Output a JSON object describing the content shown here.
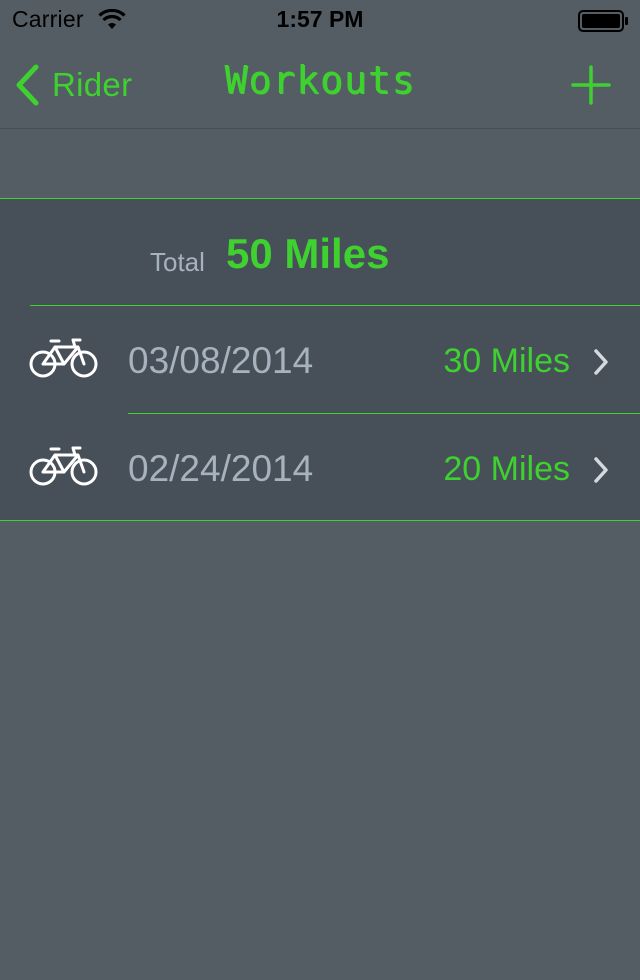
{
  "status_bar": {
    "carrier": "Carrier",
    "time": "1:57 PM"
  },
  "nav": {
    "back_label": "Rider",
    "title": "Workouts",
    "add_icon": "plus-icon"
  },
  "summary": {
    "label": "Total",
    "value": "50 Miles"
  },
  "workouts": [
    {
      "date": "03/08/2014",
      "miles": "30 Miles",
      "icon": "bicycle-icon"
    },
    {
      "date": "02/24/2014",
      "miles": "20 Miles",
      "icon": "bicycle-icon"
    }
  ],
  "colors": {
    "accent": "#3ed12f",
    "background": "#535d63",
    "section": "#474f58",
    "secondary_text": "#a6b3bf"
  }
}
